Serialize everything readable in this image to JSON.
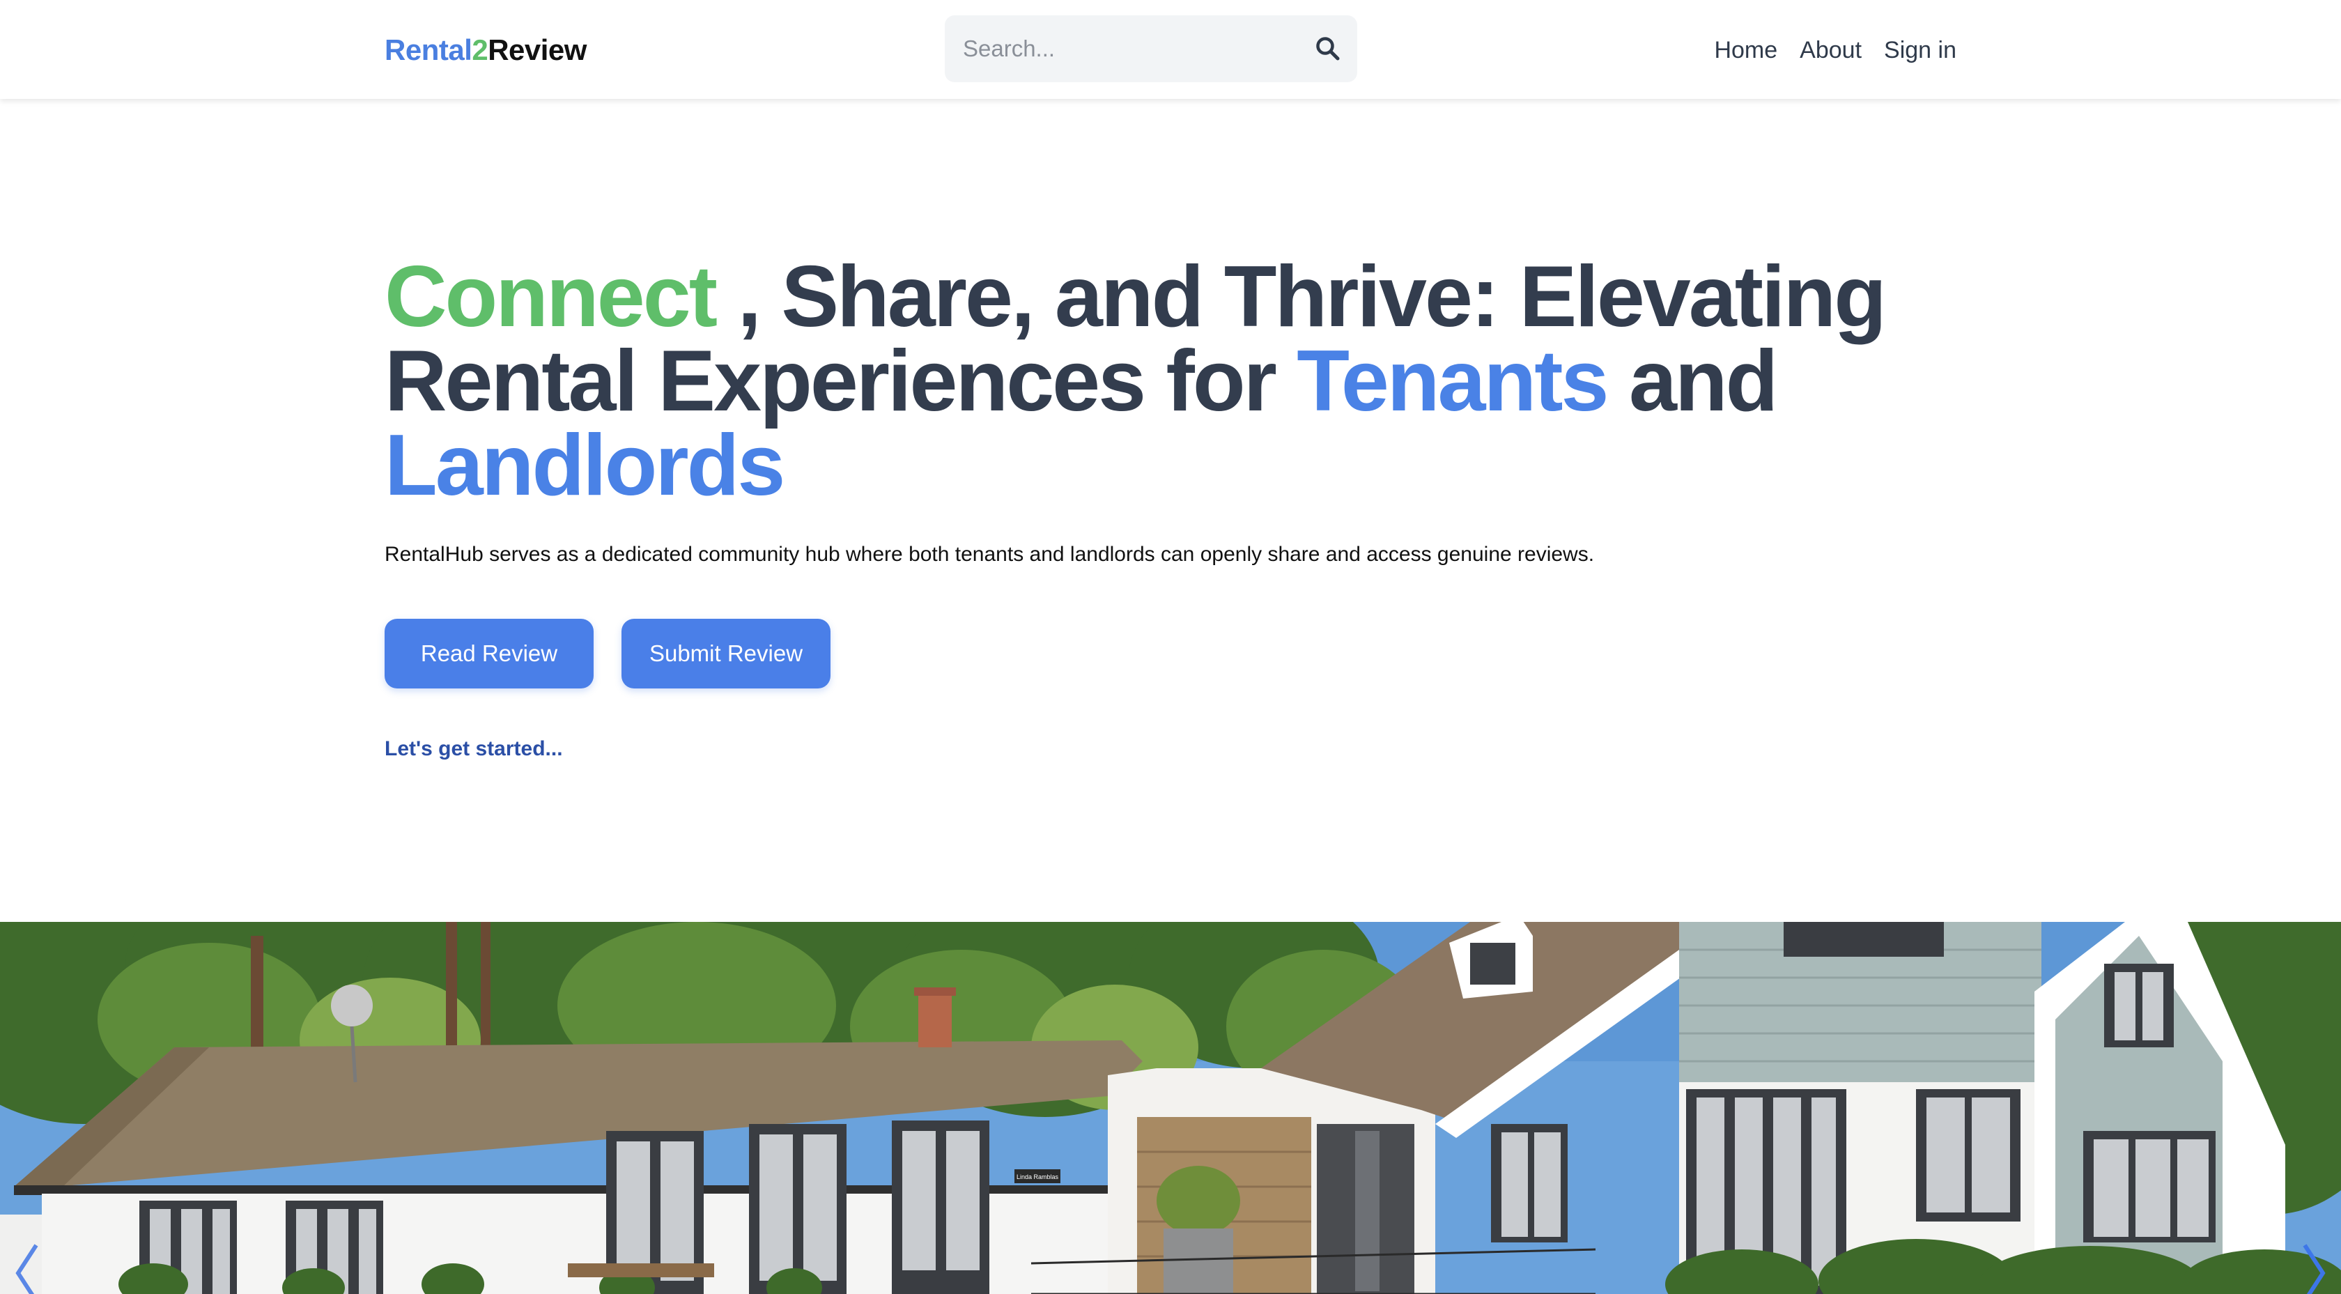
{
  "brand": {
    "part1": "Rental",
    "part2": "2",
    "part3": "Review"
  },
  "search": {
    "placeholder": "Search...",
    "value": ""
  },
  "nav": {
    "home": "Home",
    "about": "About",
    "sign_in": "Sign in"
  },
  "hero": {
    "title_connect": "Connect",
    "title_part2": " , Share, and Thrive: Elevating Rental Experiences for ",
    "title_tenants": "Tenants",
    "title_and": " and ",
    "title_landlords": "Landlords",
    "subtitle": "RentalHub serves as a dedicated community hub where both tenants and landlords can openly share and access genuine reviews.",
    "read_button": "Read Review",
    "submit_button": "Submit Review",
    "get_started": "Let's get started..."
  },
  "carousel": {
    "sign_text": "Linda Ramblas",
    "prev_icon": "chevron-left-icon",
    "next_icon": "chevron-right-icon"
  },
  "colors": {
    "brand_blue": "#4a7fe0",
    "brand_green": "#5fbe6a",
    "title_dark": "#333d4e",
    "button_blue": "#4a7fe8",
    "link_blue": "#2b4fa6"
  }
}
